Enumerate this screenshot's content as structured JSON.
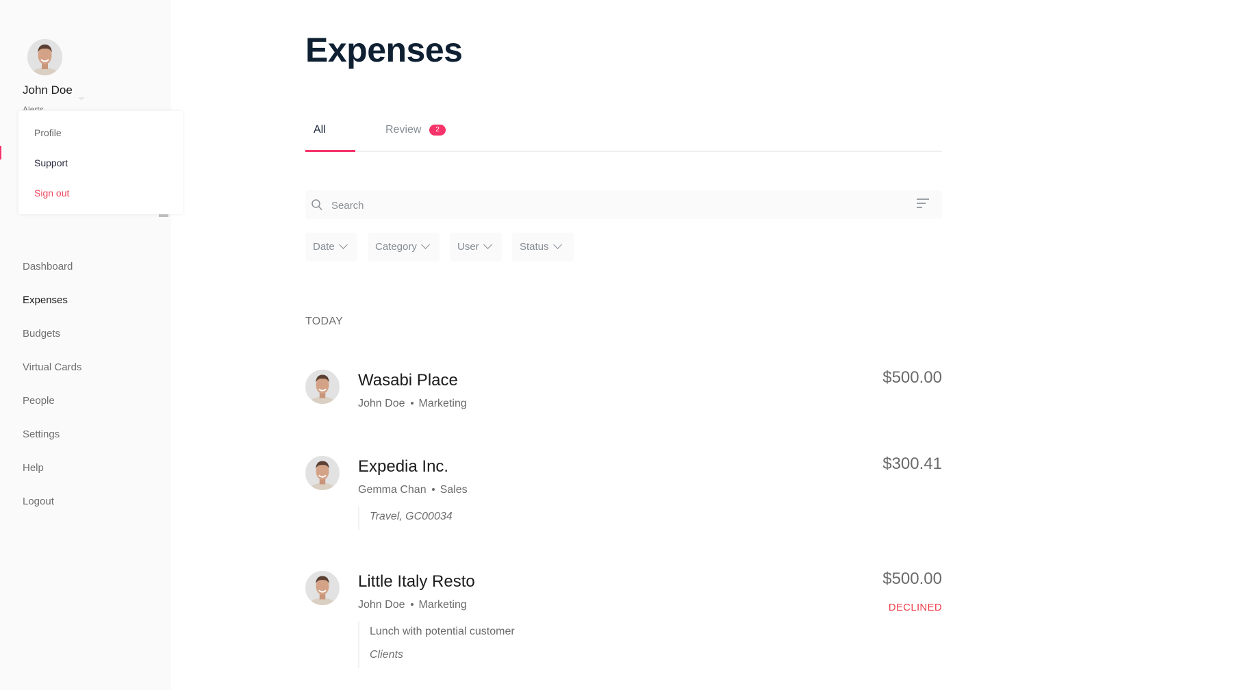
{
  "sidebar": {
    "user_name": "John Doe",
    "alerts_label": "Alerts",
    "dropdown": {
      "items": [
        {
          "label": "Profile"
        },
        {
          "label": "Support"
        },
        {
          "label": "Sign out"
        }
      ]
    },
    "nav": [
      {
        "label": "Dashboard",
        "active": false
      },
      {
        "label": "Expenses",
        "active": true
      },
      {
        "label": "Budgets",
        "active": false
      },
      {
        "label": "Virtual Cards",
        "active": false
      },
      {
        "label": "People",
        "active": false
      },
      {
        "label": "Settings",
        "active": false
      },
      {
        "label": "Help",
        "active": false
      },
      {
        "label": "Logout",
        "active": false
      }
    ]
  },
  "page": {
    "title": "Expenses",
    "tabs": [
      {
        "label": "All",
        "active": true
      },
      {
        "label": "Review",
        "badge": "2",
        "active": false
      }
    ],
    "search": {
      "placeholder": "Search",
      "value": ""
    },
    "filters": [
      {
        "label": "Date"
      },
      {
        "label": "Category"
      },
      {
        "label": "User"
      },
      {
        "label": "Status"
      }
    ],
    "section_label": "TODAY",
    "expenses": [
      {
        "merchant": "Wasabi Place",
        "user": "John Doe",
        "department": "Marketing",
        "amount": "$500.00",
        "status": "",
        "note_lines": []
      },
      {
        "merchant": "Expedia Inc.",
        "user": "Gemma Chan",
        "department": "Sales",
        "amount": "$300.41",
        "status": "",
        "note_lines": [
          {
            "text": "Travel, GC00034",
            "italic": true
          }
        ]
      },
      {
        "merchant": "Little Italy Resto",
        "user": "John Doe",
        "department": "Marketing",
        "amount": "$500.00",
        "status": "DECLINED",
        "note_lines": [
          {
            "text": "Lunch with potential customer",
            "italic": false
          },
          {
            "text": "Clients",
            "italic": true
          }
        ]
      }
    ]
  },
  "colors": {
    "accent": "#f7336a",
    "declined": "#ef3e4a",
    "title": "#0f2033",
    "sidebar_bg": "#fafafa"
  },
  "icons": {
    "search": "search-icon",
    "filter": "filter-lines-icon",
    "chevron": "chevron-down-icon",
    "avatar": "user-avatar"
  }
}
